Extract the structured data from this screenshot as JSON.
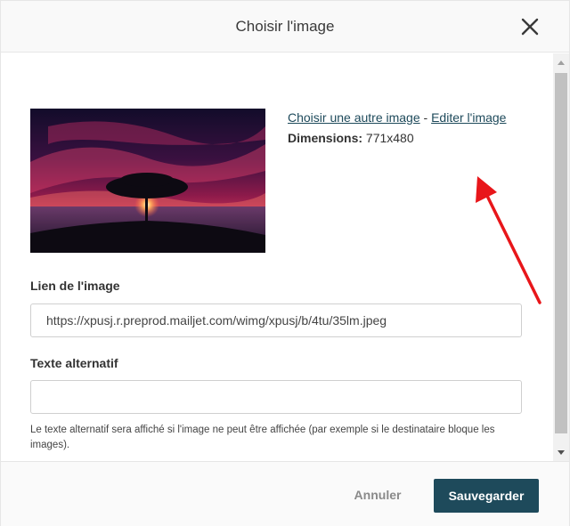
{
  "dialog": {
    "title": "Choisir l'image",
    "close_icon": "close-icon"
  },
  "image": {
    "preview_icon": "sunset-tree-photo",
    "choose_other_label": "Choisir une autre image",
    "separator": " - ",
    "edit_label": "Editer l'image",
    "dimensions_label": "Dimensions:",
    "dimensions_value": " 771x480"
  },
  "form": {
    "link_label": "Lien de l'image",
    "link_value": "https://xpusj.r.preprod.mailjet.com/wimg/xpusj/b/4tu/35lm.jpeg",
    "alt_label": "Texte alternatif",
    "alt_value": "",
    "alt_hint": "Le texte alternatif sera affiché si l'image ne peut être affichée (par exemple si le destinataire bloque les images)."
  },
  "footer": {
    "cancel_label": "Annuler",
    "save_label": "Sauvegarder"
  },
  "colors": {
    "primary": "#1e4a5b",
    "annotation_arrow": "#e8161a"
  }
}
